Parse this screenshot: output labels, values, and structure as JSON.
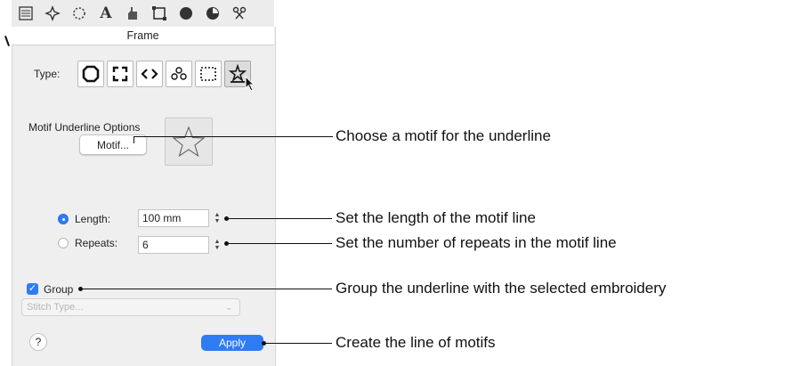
{
  "toolbar": {
    "icons": [
      "list-icon",
      "sparkle-icon",
      "dotted-circle-icon",
      "text-icon",
      "hand-icon",
      "frame-icon",
      "filled-circle-icon",
      "pie-icon",
      "scissors-icon"
    ]
  },
  "panel": {
    "title": "Frame",
    "type_label": "Type:",
    "type_buttons": [
      "octagon-icon",
      "bracket-corners-icon",
      "angle-brackets-icon",
      "ornament-icon",
      "dashed-rectangle-icon",
      "star-underline-icon"
    ],
    "motif_section_title": "Motif Underline Options",
    "motif_button_label": "Motif...",
    "length_label": "Length:",
    "length_value": "100 mm",
    "repeats_label": "Repeats:",
    "repeats_value": "6",
    "selected_option": "Length",
    "group_label": "Group",
    "group_checked": true,
    "stitch_type_placeholder": "Stitch Type...",
    "help_label": "?",
    "apply_label": "Apply"
  },
  "callouts": {
    "motif": "Choose a motif for the underline",
    "length": "Set the length of the motif line",
    "repeats": "Set the number of repeats in the motif line",
    "group": "Group the underline with the selected embroidery",
    "apply": "Create the line of motifs"
  },
  "colors": {
    "accent": "#2f7bf6",
    "panel_bg": "#efefef"
  }
}
